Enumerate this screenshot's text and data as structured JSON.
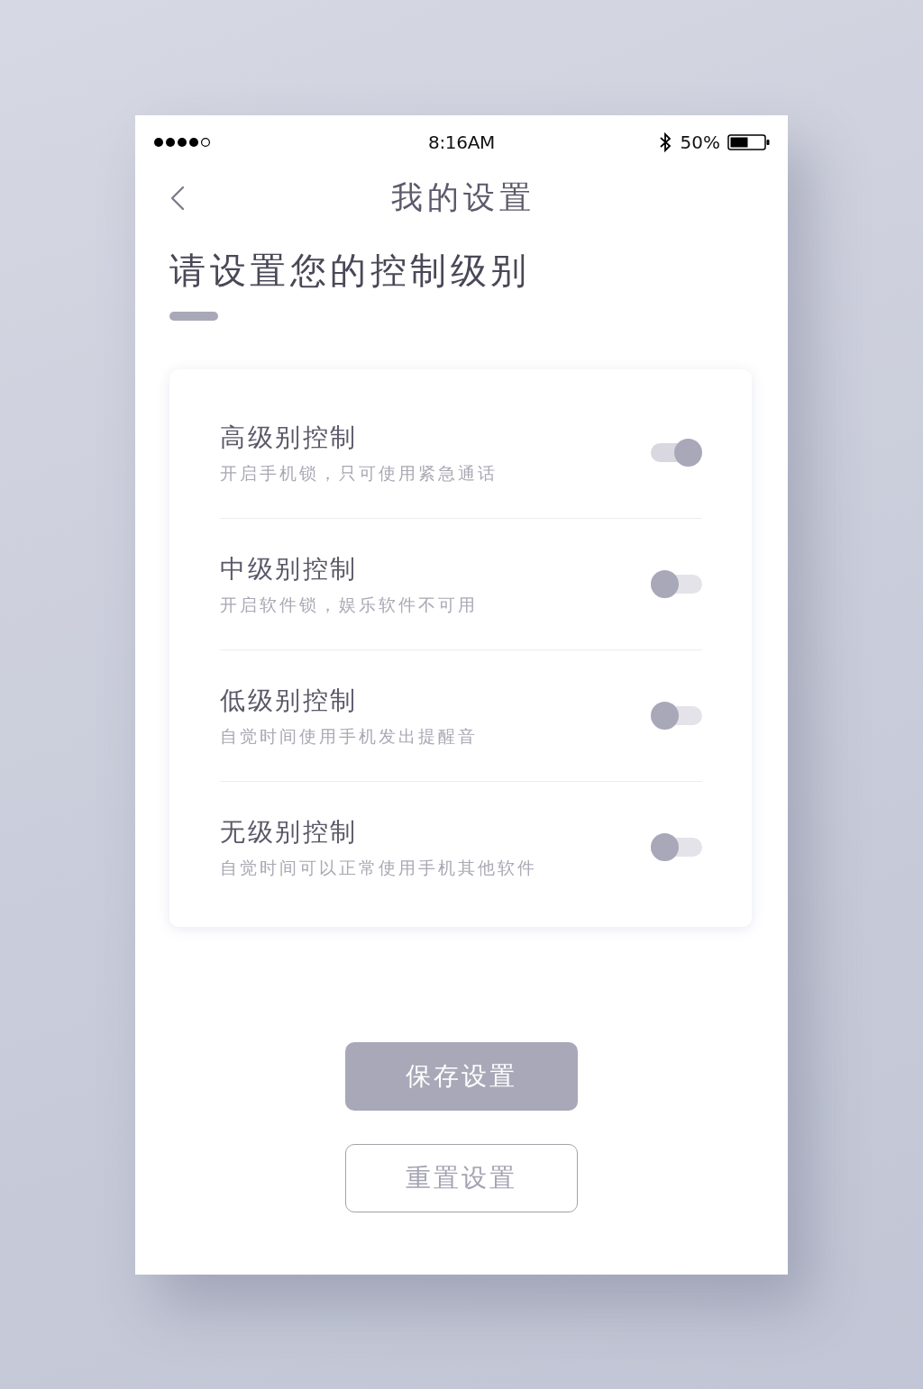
{
  "status_bar": {
    "time": "8:16AM",
    "battery": "50%"
  },
  "nav": {
    "title": "我的设置"
  },
  "heading": "请设置您的控制级别",
  "levels": [
    {
      "title": "高级别控制",
      "description": "开启手机锁，只可使用紧急通话",
      "on": true
    },
    {
      "title": "中级别控制",
      "description": "开启软件锁，娱乐软件不可用",
      "on": false
    },
    {
      "title": "低级别控制",
      "description": "自觉时间使用手机发出提醒音",
      "on": false
    },
    {
      "title": "无级别控制",
      "description": "自觉时间可以正常使用手机其他软件",
      "on": false
    }
  ],
  "buttons": [
    {
      "label": "保存设置",
      "kind": "primary"
    },
    {
      "label": "重置设置",
      "kind": "outline"
    }
  ]
}
